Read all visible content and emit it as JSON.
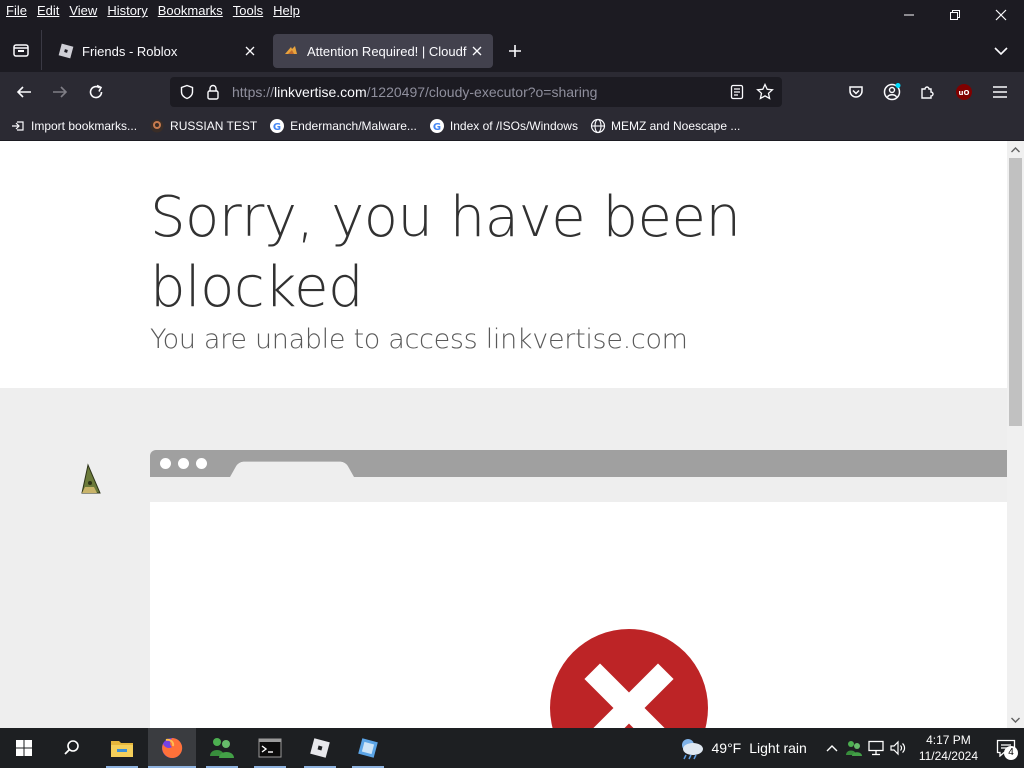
{
  "menu": {
    "items": [
      {
        "id": "file",
        "label": "File"
      },
      {
        "id": "edit",
        "label": "Edit"
      },
      {
        "id": "view",
        "label": "View"
      },
      {
        "id": "history",
        "label": "History"
      },
      {
        "id": "bookmarks",
        "label": "Bookmarks"
      },
      {
        "id": "tools",
        "label": "Tools"
      },
      {
        "id": "help",
        "label": "Help"
      }
    ]
  },
  "tabs": [
    {
      "title": "Friends - Roblox",
      "icon": "roblox-icon",
      "active": false
    },
    {
      "title": "Attention Required! | Cloudflare",
      "icon": "cloudflare-icon",
      "active": true
    }
  ],
  "urlbar": {
    "prefix": "https://",
    "host": "linkvertise.com",
    "path": "/1220497/cloudy-executor?o=sharing"
  },
  "bookmarks": [
    {
      "label": "Import bookmarks...",
      "icon": "import-icon"
    },
    {
      "label": "RUSSIAN TEST",
      "icon": "bookmark-favicon"
    },
    {
      "label": "Endermanch/Malware...",
      "icon": "google-icon"
    },
    {
      "label": "Index of /ISOs/Windows",
      "icon": "google-icon"
    },
    {
      "label": "MEMZ and Noescape ...",
      "icon": "globe-icon"
    }
  ],
  "page": {
    "heading": "Sorry, you have been blocked",
    "subheading": "You are unable to access linkvertise.com"
  },
  "taskbar": {
    "weather_temp": "49°F",
    "weather_desc": "Light rain",
    "time": "4:17 PM",
    "date": "11/24/2024",
    "notification_count": "4"
  },
  "colors": {
    "browser_dark": "#1c1b22",
    "toolbar": "#2b2a33",
    "active_tab": "#42414d",
    "error_red": "#bd2426",
    "ublock_red": "#800000"
  }
}
